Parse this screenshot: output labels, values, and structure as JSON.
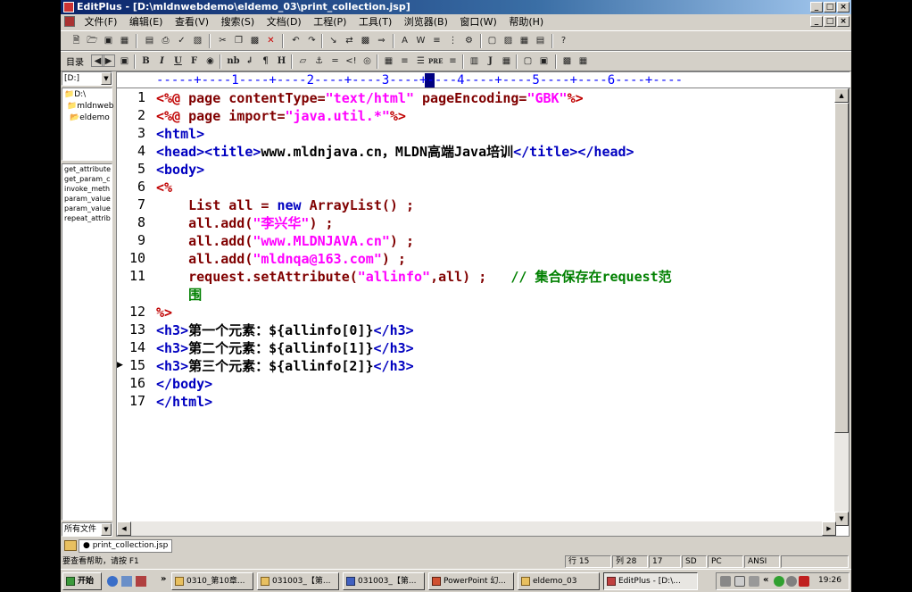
{
  "window": {
    "title": "EditPlus - [D:\\mldnwebdemo\\eldemo_03\\print_collection.jsp]",
    "controls": [
      "_",
      "□",
      "×"
    ]
  },
  "menu": [
    "文件(F)",
    "编辑(E)",
    "查看(V)",
    "搜索(S)",
    "文档(D)",
    "工程(P)",
    "工具(T)",
    "浏览器(B)",
    "窗口(W)",
    "帮助(H)"
  ],
  "format_toolbar": {
    "directory_label": "目录",
    "bold": "B",
    "italic": "I",
    "underline": "U",
    "font": "F",
    "nbsp": "nb",
    "br": "↲",
    "para": "¶",
    "h": "H",
    "pre": "PRE",
    "j": "J"
  },
  "left": {
    "drive": "[D:]",
    "tree": [
      "D:\\",
      "mldnweb",
      "eldemo"
    ],
    "cliptext": [
      "get_attribute",
      "get_param_c",
      "invoke_meth",
      "param_value",
      "param_value",
      "repeat_attrib"
    ],
    "filter": "所有文件"
  },
  "ruler": "-----+----1----+----2----+----3----+----4----+----5----+----6----+----",
  "line_numbers": [
    "1",
    "2",
    "3",
    "4",
    "5",
    "6",
    "7",
    "8",
    "9",
    "10",
    "11",
    "",
    "12",
    "13",
    "14",
    "15",
    "16",
    "17"
  ],
  "code": {
    "l1": {
      "a": "<%@ ",
      "b": "page ",
      "c": "contentType=",
      "d": "\"text/html\" ",
      "e": "pageEncoding=",
      "f": "\"GBK\"",
      "g": "%>"
    },
    "l2": {
      "a": "<%@ ",
      "b": "page ",
      "c": "import=",
      "d": "\"java.util.*\"",
      "e": "%>"
    },
    "l3": "<html>",
    "l4": {
      "a": "<head><title>",
      "b": "www.mldnjava.cn，MLDN高端Java培训",
      "c": "</title></head>"
    },
    "l5": "<body>",
    "l6": "<%",
    "l7": {
      "a": "    List all = ",
      "b": "new ",
      "c": "ArrayList() ;"
    },
    "l8": {
      "a": "    all.add(",
      "b": "\"李兴华\"",
      "c": ") ;"
    },
    "l9": {
      "a": "    all.add(",
      "b": "\"www.MLDNJAVA.cn\"",
      "c": ") ;"
    },
    "l10": {
      "a": "    all.add(",
      "b": "\"mldnqa@163.com\"",
      "c": ") ;"
    },
    "l11": {
      "a": "    request.setAttribute(",
      "b": "\"allinfo\"",
      "c": ",all) ;   ",
      "d": "// 集合保存在request范"
    },
    "l11b": "    围",
    "l12": "%>",
    "l13": {
      "a": "<h3>",
      "b": "第一个元素：${allinfo[0]}",
      "c": "</h3>"
    },
    "l14": {
      "a": "<h3>",
      "b": "第二个元素：${allinfo[1]}",
      "c": "</h3>"
    },
    "l15": {
      "a": "<h3>",
      "b": "第三个元素：${allinfo[2]}",
      "c": "</h3>"
    },
    "l16": "</body>",
    "l17": "</html>"
  },
  "doc_tab": "print_collection.jsp",
  "status": {
    "help": "要查看帮助，请按 F1",
    "row": "行 15",
    "col": "列 28",
    "num": "17",
    "sd": "SD",
    "pc": "PC",
    "enc": "ANSI"
  },
  "taskbar": {
    "start": "开始",
    "chevron": "»",
    "items": [
      "0310_第10章...",
      "031003_【第...",
      "031003_【第...",
      "PowerPoint 幻...",
      "eldemo_03",
      "EditPlus - [D:\\..."
    ],
    "tray_chevron": "«",
    "clock": "19:26"
  },
  "colors": {
    "tag": "#0000c0",
    "jsp": "#c00000",
    "string": "#ff00ff",
    "comment": "#008000",
    "title_start": "#0a246a"
  }
}
